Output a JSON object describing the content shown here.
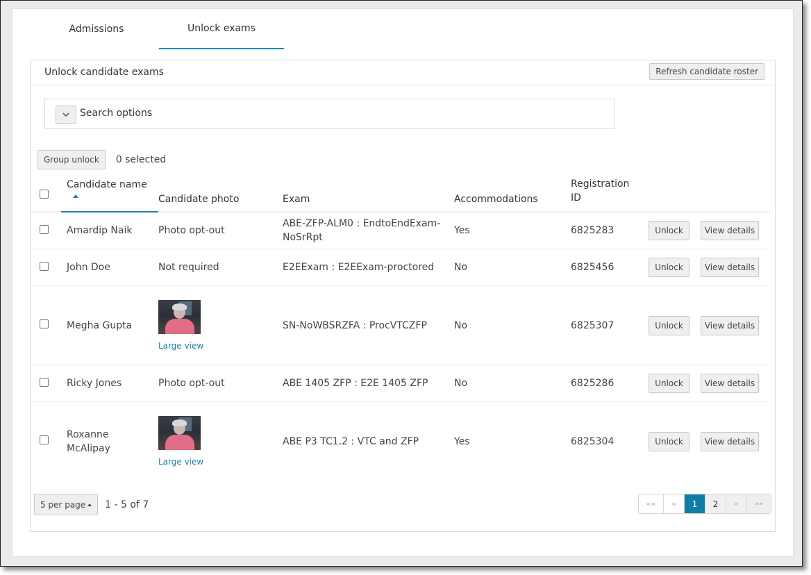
{
  "tabs": [
    {
      "label": "Admissions",
      "active": false
    },
    {
      "label": "Unlock exams",
      "active": true
    }
  ],
  "card": {
    "title": "Unlock candidate exams",
    "refresh_label": "Refresh candidate roster"
  },
  "search": {
    "toggle_icon": "chevron-down-icon",
    "label": "Search options"
  },
  "group": {
    "button_label": "Group unlock",
    "selected_text": "0 selected"
  },
  "table": {
    "columns": {
      "name": "Candidate name",
      "photo": "Candidate photo",
      "exam": "Exam",
      "accommodations": "Accommodations",
      "registration": "Registration ID"
    },
    "sort": {
      "column": "name",
      "direction": "ascending"
    },
    "rows": [
      {
        "name": "Amardip Naik",
        "photo": "Photo opt-out",
        "has_photo": false,
        "exam": "ABE-ZFP-ALM0 : EndtoEndExam-NoSrRpt",
        "accommodations": "Yes",
        "registration_id": "6825283",
        "unlock": "Unlock",
        "details": "View details"
      },
      {
        "name": "John Doe",
        "photo": "Not required",
        "has_photo": false,
        "exam": "E2EExam : E2EExam-proctored",
        "accommodations": "No",
        "registration_id": "6825456",
        "unlock": "Unlock",
        "details": "View details"
      },
      {
        "name": "Megha Gupta",
        "photo": "",
        "has_photo": true,
        "photo_link": "Large view",
        "exam": "SN-NoWBSRZFA : ProcVTCZFP",
        "accommodations": "No",
        "registration_id": "6825307",
        "unlock": "Unlock",
        "details": "View details"
      },
      {
        "name": "Ricky Jones",
        "photo": "Photo opt-out",
        "has_photo": false,
        "exam": "ABE 1405 ZFP : E2E 1405 ZFP",
        "accommodations": "No",
        "registration_id": "6825286",
        "unlock": "Unlock",
        "details": "View details"
      },
      {
        "name": "Roxanne McAlipay",
        "photo": "",
        "has_photo": true,
        "photo_link": "Large view",
        "exam": "ABE P3 TC1.2 : VTC and ZFP",
        "accommodations": "Yes",
        "registration_id": "6825304",
        "unlock": "Unlock",
        "details": "View details"
      }
    ]
  },
  "pagination": {
    "per_page_label": "5 per page",
    "range_text": "1 - 5 of 7",
    "first": "««",
    "prev": "«",
    "pages": [
      "1",
      "2"
    ],
    "current_page": "1",
    "next": "»",
    "last": "»»"
  },
  "colors": {
    "accent": "#1a7fa5",
    "active_page": "#0f7ea7"
  }
}
